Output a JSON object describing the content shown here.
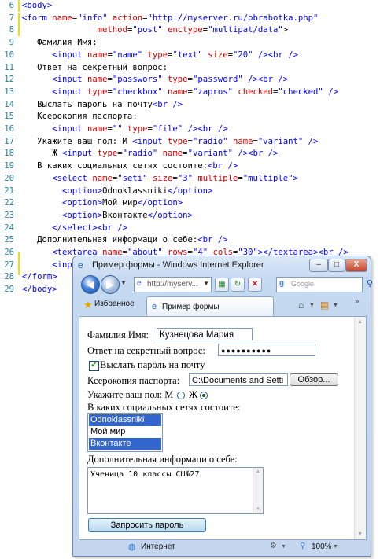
{
  "editor": {
    "lines": [
      {
        "num": "6",
        "code": "<body>"
      },
      {
        "num": "7",
        "code": "<form name=\"info\" action=\"http://myserver.ru/obrabotka.php\""
      },
      {
        "num": "8",
        "code": "               method=\"post\" enctype=\"multipat/data\">"
      },
      {
        "num": "9",
        "code": "   Фамилия Имя:"
      },
      {
        "num": "10",
        "code": "      <input name=\"name\" type=\"text\" size=\"20\" /><br />"
      },
      {
        "num": "11",
        "code": "   Ответ на секретный вопрос:"
      },
      {
        "num": "12",
        "code": "      <input name=\"passwors\" type=\"password\" /><br />"
      },
      {
        "num": "13",
        "code": "      <input type=\"checkbox\" name=\"zapros\" checked=\"checked\" />"
      },
      {
        "num": "14",
        "code": "   Выслать пароль на почту<br />"
      },
      {
        "num": "15",
        "code": "   Ксерокопия паспорта:"
      },
      {
        "num": "16",
        "code": "      <input name=\"\" type=\"file\" /><br />"
      },
      {
        "num": "17",
        "code": "   Укажите ваш пол: М <input type=\"radio\" name=\"variant\" />"
      },
      {
        "num": "18",
        "code": "      Ж <input type=\"radio\" name=\"variant\" /><br />"
      },
      {
        "num": "19",
        "code": "   В каких социальных сетях состоите:<br />"
      },
      {
        "num": "20",
        "code": "      <select name=\"seti\" size=\"3\" multiple=\"multiple\">"
      },
      {
        "num": "21",
        "code": "        <option>Odnoklassniki</option>"
      },
      {
        "num": "22",
        "code": "        <option>Мой мир</option>"
      },
      {
        "num": "23",
        "code": "        <option>Вконтакте</option>"
      },
      {
        "num": "24",
        "code": "      </select><br />"
      },
      {
        "num": "25",
        "code": "   Дополнительная информаци о себе:<br />"
      },
      {
        "num": "26",
        "code": "      <textarea name=\"about\" rows=\"4\" cols=\"30\"></textarea><br />"
      },
      {
        "num": "27",
        "code": "      <input type=\"submit\" name=\"send\" value=\"Запросить пароль\" />"
      },
      {
        "num": "28",
        "code": "</form>"
      },
      {
        "num": "29",
        "code": "</body>"
      }
    ]
  },
  "browser": {
    "title": "Пример формы - Windows Internet Explorer",
    "minimize": "–",
    "maximize": "□",
    "close": "X",
    "address": "http://myserv...",
    "search_placeholder": "Google",
    "favorites_label": "Избранное",
    "tab_label": "Пример формы",
    "status_zone": "Интернет",
    "zoom": "100%"
  },
  "form": {
    "name_label": "Фамилия Имя:",
    "name_value": "Кузнецова Мария",
    "secret_label": "Ответ на секретный вопрос:",
    "password_mask": "●●●●●●●●●●",
    "checkbox_label": "Выслать пароль на почту",
    "checkbox_checked": true,
    "passport_label": "Ксерокопия паспорта:",
    "file_value": "C:\\Documents and Setti",
    "browse_label": "Обзор...",
    "gender_label": "Укажите ваш пол: М",
    "gender_f": "Ж",
    "selected_gender": "Ж",
    "social_label": "В каких социальных сетях состоите:",
    "social_options": [
      {
        "label": "Odnoklassniki",
        "selected": true
      },
      {
        "label": "Мой мир",
        "selected": false
      },
      {
        "label": "Вконтакте",
        "selected": true
      }
    ],
    "about_label": "Дополнительная информаци о себе:",
    "about_value": "Ученица 10 классы СШ№27",
    "submit_label": "Запросить пароль"
  },
  "colors": {
    "tag": "#0000ff",
    "attribute": "#cc0000",
    "line_number": "#2a7f9f",
    "selection": "#3366cc"
  }
}
